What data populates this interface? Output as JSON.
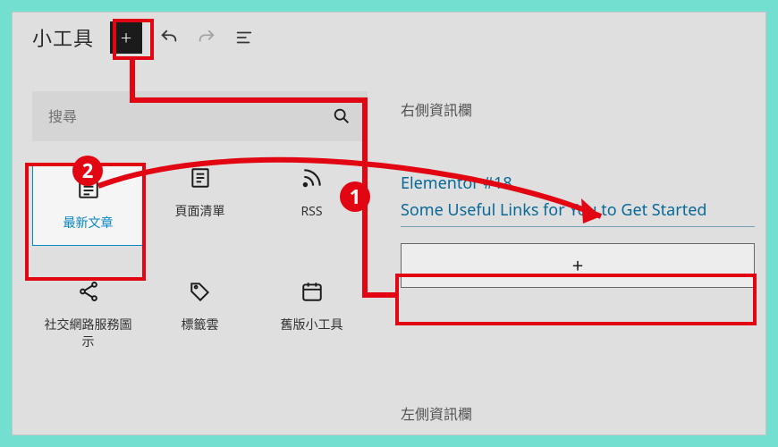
{
  "topbar": {
    "title": "小工具",
    "add_glyph": "+"
  },
  "search": {
    "placeholder": "搜尋"
  },
  "blocks": {
    "a": {
      "label": "最新文章"
    },
    "b": {
      "label": "頁面清單"
    },
    "c": {
      "label": "RSS"
    },
    "d": {
      "label": "社交網路服務圖示"
    },
    "e": {
      "label": "標籤雲"
    },
    "f": {
      "label": "舊版小工具"
    }
  },
  "right": {
    "area_title": "右側資訊欄",
    "link1": "Elementor #18",
    "link2": "Some Useful Links for You to Get Started",
    "add_glyph": "+",
    "area_title2": "左側資訊欄"
  },
  "annot": {
    "badge1": "1",
    "badge2": "2"
  },
  "colors": {
    "teal_frame": "#72dfd0",
    "red": "#e20613",
    "sel_blue": "#0a8ccc",
    "link_blue": "#0a6e9e"
  }
}
